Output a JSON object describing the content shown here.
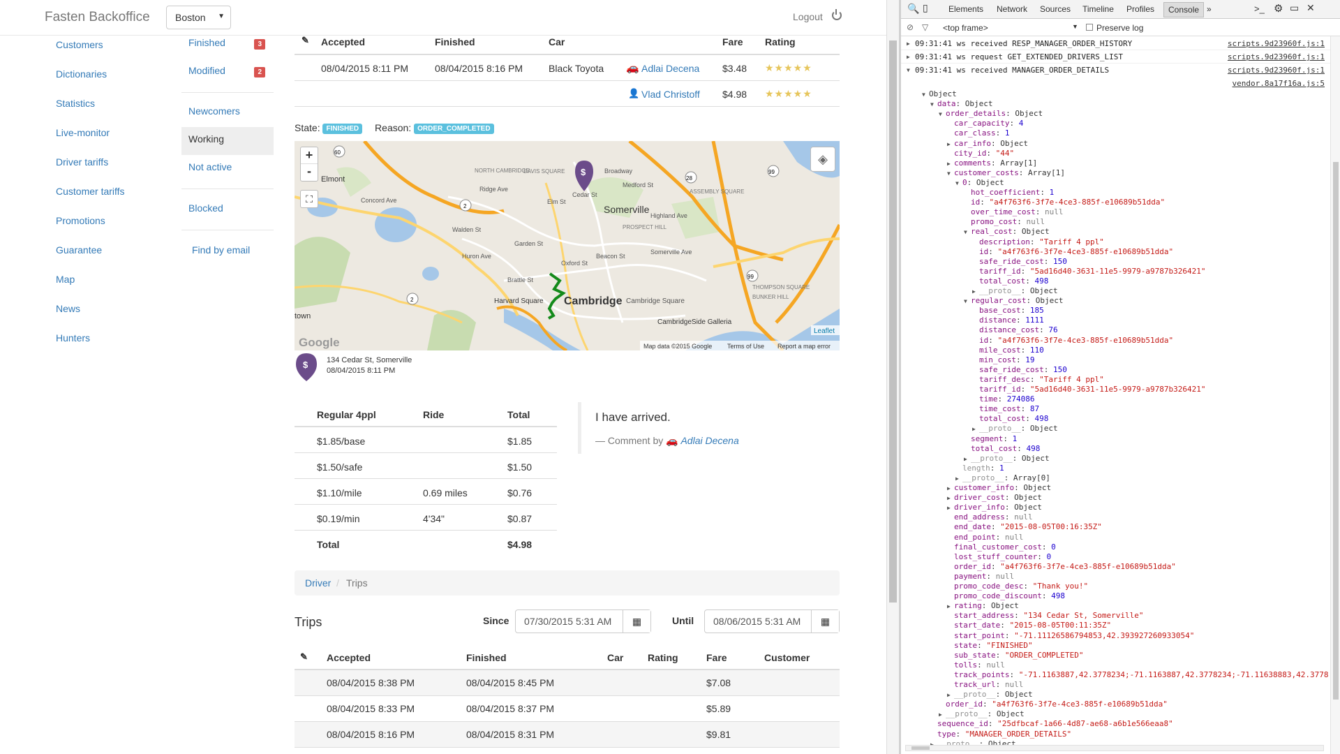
{
  "header": {
    "brand": "Fasten Backoffice",
    "city": "Boston",
    "logout": "Logout"
  },
  "sidebar_main": [
    "Customers",
    "Dictionaries",
    "Statistics",
    "Live-monitor",
    "Driver tariffs",
    "Customer tariffs",
    "Promotions",
    "Guarantee",
    "Map",
    "News",
    "Hunters"
  ],
  "sidebar_sub": {
    "finished": "Finished",
    "finished_count": "3",
    "modified": "Modified",
    "modified_count": "2",
    "newcomers": "Newcomers",
    "working": "Working",
    "not_active": "Not active",
    "blocked": "Blocked",
    "find_by_email": "Find by email"
  },
  "order_table": {
    "headers": {
      "accepted": "Accepted",
      "finished": "Finished",
      "car": "Car",
      "fare": "Fare",
      "rating": "Rating"
    },
    "rows": [
      {
        "accepted": "08/04/2015 8:11 PM",
        "finished": "08/04/2015 8:16 PM",
        "car": "Black Toyota",
        "person": "Adlai Decena",
        "fare": "$3.48",
        "stars": "★★★★★"
      },
      {
        "person": "Vlad Christoff",
        "fare": "$4.98",
        "stars": "★★★★★"
      }
    ]
  },
  "state": {
    "state_label": "State:",
    "state_value": "FINISHED",
    "reason_label": "Reason:",
    "reason_value": "ORDER_COMPLETED"
  },
  "map": {
    "zoom_in": "+",
    "zoom_out": "-",
    "labels": {
      "somerville": "Somerville",
      "cambridge": "Cambridge",
      "harvard": "Harvard Square",
      "north_cambridge": "NORTH CAMBRIDGE",
      "davis": "DAVIS SQUARE",
      "prospect": "PROSPECT HILL",
      "assembly": "ASSEMBLY SQUARE",
      "thompson": "THOMPSON SQUARE",
      "bunker": "BUNKER HILL",
      "galleria": "CambridgeSide Galleria",
      "cambridge_sq": "Cambridge Square",
      "town": "town",
      "belmont": "Elmont",
      "concord": "Concord Ave",
      "ridge": "Ridge Ave",
      "walden": "Walden St",
      "huron": "Huron Ave",
      "broadway": "Broadway",
      "medford": "Medford St",
      "beacon": "Beacon St",
      "somerville_ave": "Somerville Ave",
      "highland": "Highland Ave",
      "brattle": "Brattle St",
      "garden": "Garden St",
      "oxford": "Oxford St",
      "elm": "Elm St",
      "cedar": "Cedar St"
    },
    "leaflet": "Leaflet",
    "google": "Google",
    "footer_data": "Map data ©2015 Google",
    "footer_terms": "Terms of Use",
    "footer_report": "Report a map error",
    "pin_symbol": "$"
  },
  "pin_info": {
    "address": "134 Cedar St, Somerville",
    "date": "08/04/2015 8:11 PM",
    "symbol": "$"
  },
  "fare_table": {
    "headers": {
      "tariff": "Regular 4ppl",
      "ride": "Ride",
      "total": "Total"
    },
    "rows": [
      {
        "label": "$1.85/base",
        "ride": "",
        "total": "$1.85"
      },
      {
        "label": "$1.50/safe",
        "ride": "",
        "total": "$1.50"
      },
      {
        "label": "$1.10/mile",
        "ride": "0.69 miles",
        "total": "$0.76"
      },
      {
        "label": "$0.19/min",
        "ride": "4'34\"",
        "total": "$0.87"
      }
    ],
    "total_label": "Total",
    "total_value": "$4.98"
  },
  "comment": {
    "text": "I have arrived.",
    "by": "— Comment by",
    "author": "Adlai Decena"
  },
  "breadcrumb": {
    "driver": "Driver",
    "trips": "Trips",
    "sep": "/"
  },
  "trips": {
    "title": "Trips",
    "since_label": "Since",
    "since_value": "07/30/2015 5:31 AM",
    "until_label": "Until",
    "until_value": "08/06/2015 5:31 AM",
    "headers": {
      "accepted": "Accepted",
      "finished": "Finished",
      "car": "Car",
      "rating": "Rating",
      "fare": "Fare",
      "customer": "Customer"
    },
    "rows": [
      {
        "accepted": "08/04/2015 8:38 PM",
        "finished": "08/04/2015 8:45 PM",
        "fare": "$7.08"
      },
      {
        "accepted": "08/04/2015 8:33 PM",
        "finished": "08/04/2015 8:37 PM",
        "fare": "$5.89"
      },
      {
        "accepted": "08/04/2015 8:16 PM",
        "finished": "08/04/2015 8:31 PM",
        "fare": "$9.81"
      }
    ]
  },
  "devtools": {
    "tabs": [
      "Elements",
      "Network",
      "Sources",
      "Timeline",
      "Profiles",
      "Console"
    ],
    "more": "»",
    "frame": "<top frame>",
    "preserve": "Preserve log",
    "messages": [
      {
        "text": "09:31:41 ws received RESP_MANAGER_ORDER_HISTORY",
        "src": "scripts.9d23960f.js:1"
      },
      {
        "text": "09:31:41 ws request GET_EXTENDED_DRIVERS_LIST",
        "src": "scripts.9d23960f.js:1"
      },
      {
        "text": "09:31:41 ws received MANAGER_ORDER_DETAILS",
        "src": "scripts.9d23960f.js:1"
      }
    ],
    "vendor_src": "vendor.8a17f16a.js:5",
    "tree": [
      {
        "i": 0,
        "a": "▼",
        "k": "Object",
        "v": "",
        "c": ""
      },
      {
        "i": 1,
        "a": "▼",
        "k": "data",
        "v": "Object",
        "c": ""
      },
      {
        "i": 2,
        "a": "▼",
        "k": "order_details",
        "v": "Object",
        "c": ""
      },
      {
        "i": 3,
        "a": "",
        "k": "car_capacity",
        "v": "4",
        "c": "n"
      },
      {
        "i": 3,
        "a": "",
        "k": "car_class",
        "v": "1",
        "c": "n"
      },
      {
        "i": 3,
        "a": "▶",
        "k": "car_info",
        "v": "Object",
        "c": ""
      },
      {
        "i": 3,
        "a": "",
        "k": "city_id",
        "v": "\"44\"",
        "c": "s"
      },
      {
        "i": 3,
        "a": "▶",
        "k": "comments",
        "v": "Array[1]",
        "c": ""
      },
      {
        "i": 3,
        "a": "▼",
        "k": "customer_costs",
        "v": "Array[1]",
        "c": ""
      },
      {
        "i": 4,
        "a": "▼",
        "k": "0",
        "v": "Object",
        "c": ""
      },
      {
        "i": 5,
        "a": "",
        "k": "hot_coefficient",
        "v": "1",
        "c": "n"
      },
      {
        "i": 5,
        "a": "",
        "k": "id",
        "v": "\"a4f763f6-3f7e-4ce3-885f-e10689b51dda\"",
        "c": "s"
      },
      {
        "i": 5,
        "a": "",
        "k": "over_time_cost",
        "v": "null",
        "c": "nl"
      },
      {
        "i": 5,
        "a": "",
        "k": "promo_cost",
        "v": "null",
        "c": "nl"
      },
      {
        "i": 5,
        "a": "▼",
        "k": "real_cost",
        "v": "Object",
        "c": ""
      },
      {
        "i": 6,
        "a": "",
        "k": "description",
        "v": "\"Tariff 4 ppl\"",
        "c": "s"
      },
      {
        "i": 6,
        "a": "",
        "k": "id",
        "v": "\"a4f763f6-3f7e-4ce3-885f-e10689b51dda\"",
        "c": "s"
      },
      {
        "i": 6,
        "a": "",
        "k": "safe_ride_cost",
        "v": "150",
        "c": "n"
      },
      {
        "i": 6,
        "a": "",
        "k": "tariff_id",
        "v": "\"5ad16d40-3631-11e5-9979-a9787b326421\"",
        "c": "s"
      },
      {
        "i": 6,
        "a": "",
        "k": "total_cost",
        "v": "498",
        "c": "n"
      },
      {
        "i": 6,
        "a": "▶",
        "k": "__proto__",
        "v": "Object",
        "c": "",
        "g": true
      },
      {
        "i": 5,
        "a": "▼",
        "k": "regular_cost",
        "v": "Object",
        "c": ""
      },
      {
        "i": 6,
        "a": "",
        "k": "base_cost",
        "v": "185",
        "c": "n"
      },
      {
        "i": 6,
        "a": "",
        "k": "distance",
        "v": "1111",
        "c": "n"
      },
      {
        "i": 6,
        "a": "",
        "k": "distance_cost",
        "v": "76",
        "c": "n"
      },
      {
        "i": 6,
        "a": "",
        "k": "id",
        "v": "\"a4f763f6-3f7e-4ce3-885f-e10689b51dda\"",
        "c": "s"
      },
      {
        "i": 6,
        "a": "",
        "k": "mile_cost",
        "v": "110",
        "c": "n"
      },
      {
        "i": 6,
        "a": "",
        "k": "min_cost",
        "v": "19",
        "c": "n"
      },
      {
        "i": 6,
        "a": "",
        "k": "safe_ride_cost",
        "v": "150",
        "c": "n"
      },
      {
        "i": 6,
        "a": "",
        "k": "tariff_desc",
        "v": "\"Tariff 4 ppl\"",
        "c": "s"
      },
      {
        "i": 6,
        "a": "",
        "k": "tariff_id",
        "v": "\"5ad16d40-3631-11e5-9979-a9787b326421\"",
        "c": "s"
      },
      {
        "i": 6,
        "a": "",
        "k": "time",
        "v": "274086",
        "c": "n"
      },
      {
        "i": 6,
        "a": "",
        "k": "time_cost",
        "v": "87",
        "c": "n"
      },
      {
        "i": 6,
        "a": "",
        "k": "total_cost",
        "v": "498",
        "c": "n"
      },
      {
        "i": 6,
        "a": "▶",
        "k": "__proto__",
        "v": "Object",
        "c": "",
        "g": true
      },
      {
        "i": 5,
        "a": "",
        "k": "segment",
        "v": "1",
        "c": "n"
      },
      {
        "i": 5,
        "a": "",
        "k": "total_cost",
        "v": "498",
        "c": "n"
      },
      {
        "i": 5,
        "a": "▶",
        "k": "__proto__",
        "v": "Object",
        "c": "",
        "g": true
      },
      {
        "i": 4,
        "a": "",
        "k": "length",
        "v": "1",
        "c": "n",
        "g": true
      },
      {
        "i": 4,
        "a": "▶",
        "k": "__proto__",
        "v": "Array[0]",
        "c": "",
        "g": true
      },
      {
        "i": 3,
        "a": "▶",
        "k": "customer_info",
        "v": "Object",
        "c": ""
      },
      {
        "i": 3,
        "a": "▶",
        "k": "driver_cost",
        "v": "Object",
        "c": ""
      },
      {
        "i": 3,
        "a": "▶",
        "k": "driver_info",
        "v": "Object",
        "c": ""
      },
      {
        "i": 3,
        "a": "",
        "k": "end_address",
        "v": "null",
        "c": "nl"
      },
      {
        "i": 3,
        "a": "",
        "k": "end_date",
        "v": "\"2015-08-05T00:16:35Z\"",
        "c": "s"
      },
      {
        "i": 3,
        "a": "",
        "k": "end_point",
        "v": "null",
        "c": "nl"
      },
      {
        "i": 3,
        "a": "",
        "k": "final_customer_cost",
        "v": "0",
        "c": "n"
      },
      {
        "i": 3,
        "a": "",
        "k": "lost_stuff_counter",
        "v": "0",
        "c": "n"
      },
      {
        "i": 3,
        "a": "",
        "k": "order_id",
        "v": "\"a4f763f6-3f7e-4ce3-885f-e10689b51dda\"",
        "c": "s"
      },
      {
        "i": 3,
        "a": "",
        "k": "payment",
        "v": "null",
        "c": "nl"
      },
      {
        "i": 3,
        "a": "",
        "k": "promo_code_desc",
        "v": "\"Thank you!\"",
        "c": "s"
      },
      {
        "i": 3,
        "a": "",
        "k": "promo_code_discount",
        "v": "498",
        "c": "n"
      },
      {
        "i": 3,
        "a": "▶",
        "k": "rating",
        "v": "Object",
        "c": ""
      },
      {
        "i": 3,
        "a": "",
        "k": "start_address",
        "v": "\"134 Cedar St, Somerville\"",
        "c": "s"
      },
      {
        "i": 3,
        "a": "",
        "k": "start_date",
        "v": "\"2015-08-05T00:11:35Z\"",
        "c": "s"
      },
      {
        "i": 3,
        "a": "",
        "k": "start_point",
        "v": "\"-71.11126586794853,42.393927260933054\"",
        "c": "s"
      },
      {
        "i": 3,
        "a": "",
        "k": "state",
        "v": "\"FINISHED\"",
        "c": "s"
      },
      {
        "i": 3,
        "a": "",
        "k": "sub_state",
        "v": "\"ORDER_COMPLETED\"",
        "c": "s"
      },
      {
        "i": 3,
        "a": "",
        "k": "tolls",
        "v": "null",
        "c": "nl"
      },
      {
        "i": 3,
        "a": "",
        "k": "track_points",
        "v": "\"-71.1163887,42.3778234;-71.1163887,42.3778234;-71.11638883,42.3778",
        "c": "s"
      },
      {
        "i": 3,
        "a": "",
        "k": "track_url",
        "v": "null",
        "c": "nl"
      },
      {
        "i": 3,
        "a": "▶",
        "k": "__proto__",
        "v": "Object",
        "c": "",
        "g": true
      },
      {
        "i": 2,
        "a": "",
        "k": "order_id",
        "v": "\"a4f763f6-3f7e-4ce3-885f-e10689b51dda\"",
        "c": "s"
      },
      {
        "i": 2,
        "a": "▶",
        "k": "__proto__",
        "v": "Object",
        "c": "",
        "g": true
      },
      {
        "i": 1,
        "a": "",
        "k": "sequence_id",
        "v": "\"25dfbcaf-1a66-4d87-ae68-a6b1e566eaa8\"",
        "c": "s"
      },
      {
        "i": 1,
        "a": "",
        "k": "type",
        "v": "\"MANAGER_ORDER_DETAILS\"",
        "c": "s"
      },
      {
        "i": 1,
        "a": "▶",
        "k": "__proto__",
        "v": "Object",
        "c": "",
        "g": true
      }
    ]
  }
}
